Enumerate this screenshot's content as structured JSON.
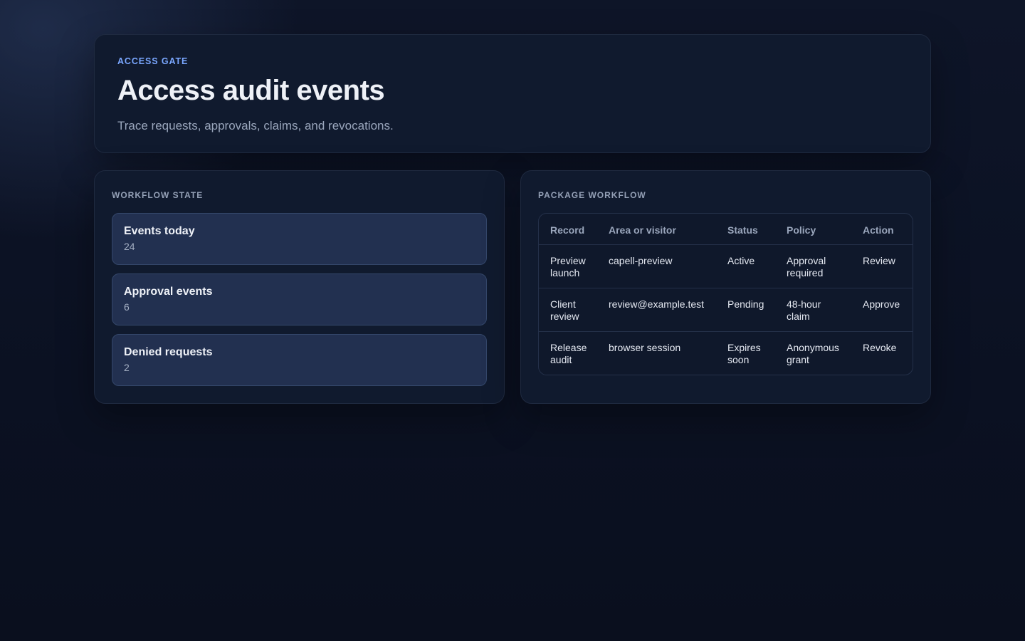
{
  "header": {
    "eyebrow": "ACCESS GATE",
    "title": "Access audit events",
    "subtitle": "Trace requests, approvals, claims, and revocations."
  },
  "workflow_state": {
    "label": "WORKFLOW STATE",
    "stats": [
      {
        "label": "Events today",
        "value": "24"
      },
      {
        "label": "Approval events",
        "value": "6"
      },
      {
        "label": "Denied requests",
        "value": "2"
      }
    ]
  },
  "package_workflow": {
    "label": "PACKAGE WORKFLOW",
    "columns": [
      "Record",
      "Area or visitor",
      "Status",
      "Policy",
      "Action"
    ],
    "rows": [
      {
        "record": "Preview launch",
        "area": "capell-preview",
        "status": "Active",
        "policy": "Approval required",
        "action": "Review"
      },
      {
        "record": "Client review",
        "area": "review@example.test",
        "status": "Pending",
        "policy": "48-hour claim",
        "action": "Approve"
      },
      {
        "record": "Release audit",
        "area": "browser session",
        "status": "Expires soon",
        "policy": "Anonymous grant",
        "action": "Revoke"
      }
    ]
  }
}
